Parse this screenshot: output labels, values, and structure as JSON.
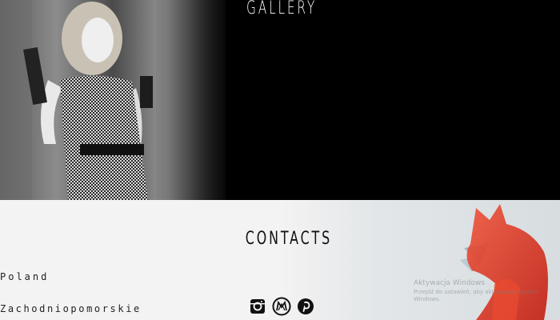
{
  "gallery": {
    "title": "GALLERY"
  },
  "contacts": {
    "title": "CONTACTS",
    "country": "Poland",
    "region": "Zachodniopomorskie",
    "socials": [
      {
        "name": "instagram-icon"
      },
      {
        "name": "modelmayhem-icon"
      },
      {
        "name": "pinterest-icon"
      }
    ]
  },
  "watermark": {
    "line1": "Aktywacja Windows",
    "line2": "Przejdź do ustawień, aby aktywować system Windows."
  }
}
